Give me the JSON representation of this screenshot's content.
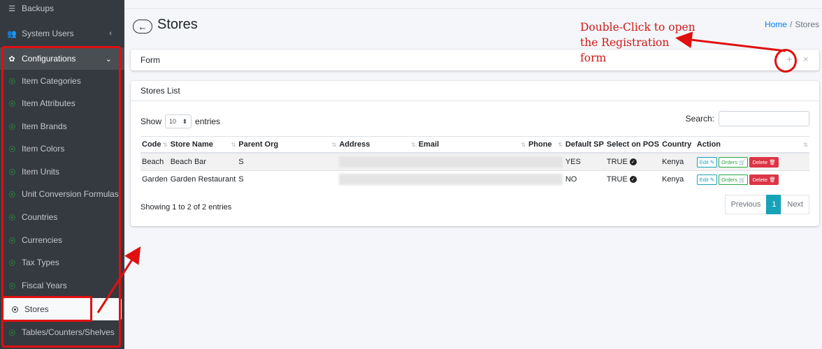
{
  "sidebar": {
    "items": [
      {
        "label": "Backups",
        "icon": "database-icon"
      },
      {
        "label": "System Users",
        "icon": "users-icon"
      },
      {
        "label": "Configurations",
        "icon": "gear-icon"
      },
      {
        "label": "Item Categories"
      },
      {
        "label": "Item Attributes"
      },
      {
        "label": "Item Brands"
      },
      {
        "label": "Item Colors"
      },
      {
        "label": "Item Units"
      },
      {
        "label": "Unit Conversion Formulas"
      },
      {
        "label": "Countries"
      },
      {
        "label": "Currencies"
      },
      {
        "label": "Tax Types"
      },
      {
        "label": "Fiscal Years"
      },
      {
        "label": "Stores"
      },
      {
        "label": "Tables/Counters/Shelves"
      }
    ],
    "active": "Stores"
  },
  "header": {
    "title": "Stores",
    "breadcrumb": {
      "home": "Home",
      "current": "Stores"
    }
  },
  "form_card": {
    "title": "Form",
    "add_symbol": "+",
    "close_symbol": "×"
  },
  "list_card": {
    "title": "Stores List",
    "show_label": "Show",
    "entries_value": "10",
    "entries_label": "entries",
    "search_label": "Search:",
    "columns": [
      "Code",
      "Store Name",
      "Parent Org",
      "Address",
      "Email",
      "Phone",
      "Default SP",
      "Select on POS",
      "Country",
      "Action"
    ],
    "rows": [
      {
        "code": "Beach",
        "store_name": "Beach Bar",
        "parent_org": "S",
        "default_sp": "YES",
        "select_on_pos": "TRUE",
        "country": "Kenya"
      },
      {
        "code": "Garden",
        "store_name": "Garden Restaurant",
        "parent_org": "S",
        "default_sp": "NO",
        "select_on_pos": "TRUE",
        "country": "Kenya"
      }
    ],
    "action_buttons": {
      "edit": "Edit",
      "orders": "Orders",
      "delete": "Delete"
    },
    "info": "Showing 1 to 2 of 2 entries",
    "pagination": {
      "previous": "Previous",
      "current": "1",
      "next": "Next"
    }
  },
  "annotation": {
    "line1": "Double-Click to open",
    "line2": "the Registration",
    "line3": "form"
  },
  "colors": {
    "sidebar_bg": "#343a40",
    "annotation_red": "#e01010",
    "accent_teal": "#17a2b8"
  }
}
